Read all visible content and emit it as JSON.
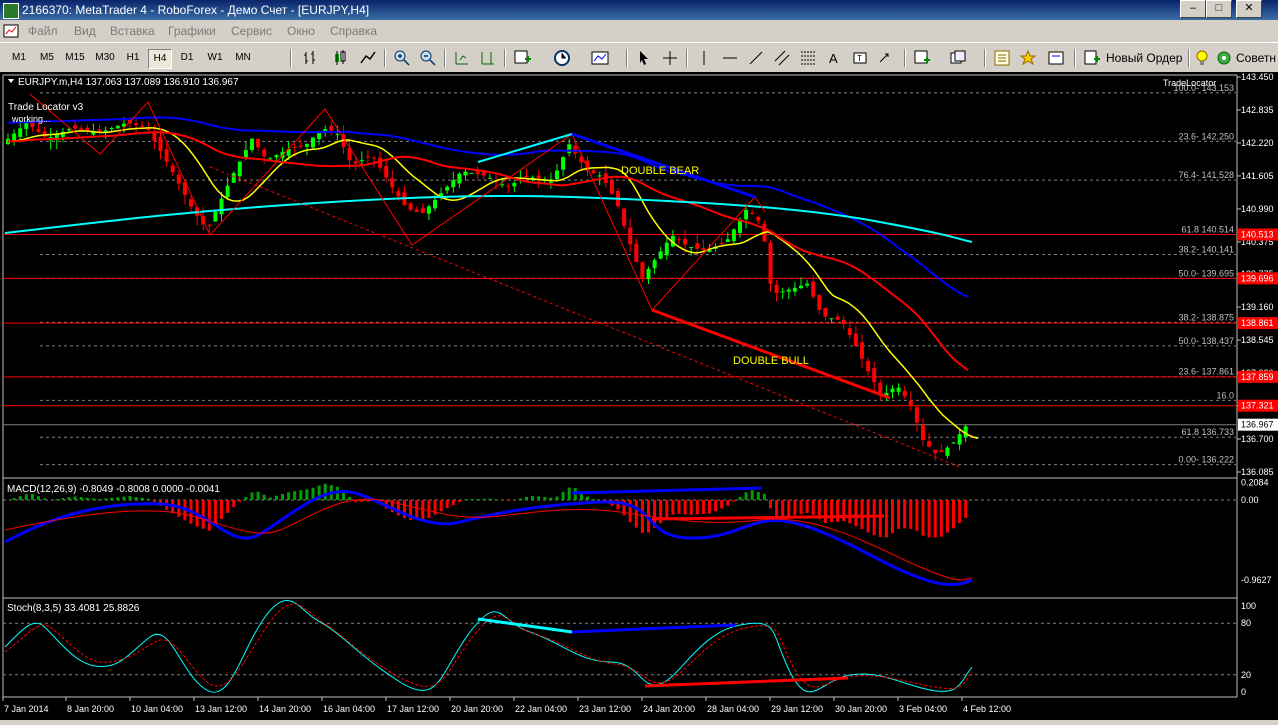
{
  "window": {
    "title": "2166370: MetaTrader 4 - RoboForex - Демо Счет - [EURJPY,H4]"
  },
  "menu": [
    "Файл",
    "Вид",
    "Вставка",
    "Графики",
    "Сервис",
    "Окно",
    "Справка"
  ],
  "timeframes": [
    "M1",
    "M5",
    "M15",
    "M30",
    "H1",
    "H4",
    "D1",
    "W1",
    "MN"
  ],
  "active_timeframe": "H4",
  "toolbar": {
    "new_order_label": "Новый Ордер",
    "advisors_label": "Советн"
  },
  "chart_header": "EURJPY.m,H4  137.063 137.089 136.910 136.967",
  "indicator_note": {
    "line1": "Trade Locator v3",
    "line2": "working..."
  },
  "tradelocator_label": "TradeLocator",
  "annotations": {
    "double_bear": "DOUBLE BEAR",
    "double_bull": "DOUBLE BULL"
  },
  "price_axis": {
    "ticks": [
      "143.450",
      "142.835",
      "142.220",
      "141.605",
      "140.990",
      "140.375",
      "139.775",
      "139.160",
      "138.545",
      "137.930",
      "137.315",
      "136.700",
      "136.085"
    ],
    "boxes": [
      {
        "label": "140.513",
        "price": 140.513,
        "bg": "#ff0000"
      },
      {
        "label": "139.696",
        "price": 139.696,
        "bg": "#ff0000"
      },
      {
        "label": "138.861",
        "price": 138.861,
        "bg": "#ff0000"
      },
      {
        "label": "137.859",
        "price": 137.859,
        "bg": "#ff0000"
      },
      {
        "label": "137.321",
        "price": 137.321,
        "bg": "#ff0000"
      },
      {
        "label": "136.967",
        "price": 136.967,
        "bg": "#ffffff"
      }
    ]
  },
  "fib_labels": [
    {
      "label": "100.0- 143.153",
      "price": 143.153
    },
    {
      "label": "23.6- 142.250",
      "price": 142.25
    },
    {
      "label": "76.4- 141.528",
      "price": 141.528
    },
    {
      "label": "61.8 140.514",
      "price": 140.514
    },
    {
      "label": "38.2- 140.141",
      "price": 140.141
    },
    {
      "label": "50.0- 139.695",
      "price": 139.695
    },
    {
      "label": "38.2- 138.875",
      "price": 138.875
    },
    {
      "label": "50.0- 138.437",
      "price": 138.437
    },
    {
      "label": "23.6- 137.861",
      "price": 137.861
    },
    {
      "label": "16.0",
      "price": 137.42
    },
    {
      "label": "61.8 136.733",
      "price": 136.733
    },
    {
      "label": "0.00- 136.222",
      "price": 136.222
    }
  ],
  "macd": {
    "label": "MACD(12,26,9) -0.8049 -0.8008 0.0000 -0.0041",
    "axis": [
      "0.2084",
      "0.00",
      "-0.9627"
    ]
  },
  "stoch": {
    "label": "Stoch(8,3,5) 33.4081 25.8826",
    "axis": [
      "100",
      "80",
      "20",
      "0"
    ]
  },
  "time_axis": [
    "7 Jan 2014",
    "8 Jan 20:00",
    "10 Jan 04:00",
    "13 Jan 12:00",
    "14 Jan 20:00",
    "16 Jan 04:00",
    "17 Jan 12:00",
    "20 Jan 20:00",
    "22 Jan 04:00",
    "23 Jan 12:00",
    "24 Jan 20:00",
    "28 Jan 04:00",
    "29 Jan 12:00",
    "30 Jan 20:00",
    "3 Feb 04:00",
    "4 Feb 12:00"
  ],
  "colors": {
    "bull": "#00ff00",
    "bear": "#ff0000",
    "ma_yellow": "#ffff00",
    "ma_red": "#ff0000",
    "ma_blue": "#0000ff",
    "ma_cyan": "#00ffff",
    "grid": "#c0c0c0"
  }
}
